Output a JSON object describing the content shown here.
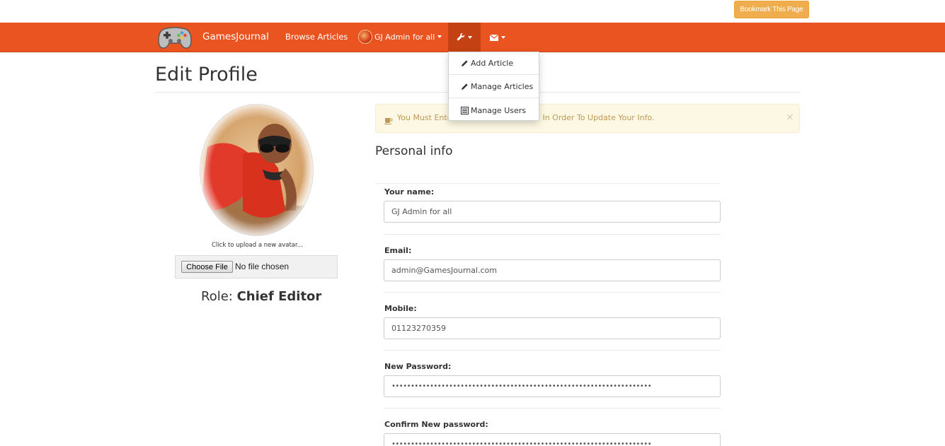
{
  "topbar": {
    "bookmark_label": "Bookmark This Page"
  },
  "navbar": {
    "brand": "GamesJournal",
    "browse_label": "Browse Articles",
    "user_label": "GJ Admin for all",
    "tools_icon": "wrench-icon",
    "mail_icon": "envelope-icon",
    "accent_color": "#e95420",
    "active_color": "#c34113"
  },
  "tools_menu": {
    "items": [
      {
        "label": "Add Article",
        "icon": "pencil-icon"
      },
      {
        "label": "Manage Articles",
        "icon": "pencil-icon"
      },
      {
        "label": "Manage Users",
        "icon": "list-icon"
      }
    ]
  },
  "page": {
    "title": "Edit Profile"
  },
  "profile": {
    "avatar_caption": "Click to upload a new avatar...",
    "choose_file_label": "Choose File",
    "no_file_label": "No file chosen",
    "role_prefix": "Role:",
    "role_value": "Chief Editor"
  },
  "alert": {
    "icon": "coffee-icon",
    "text_start": "You Must Ente",
    "text_end": "In Order To Update Your Info.",
    "close": "×"
  },
  "form": {
    "section_title": "Personal info",
    "fields": [
      {
        "label": "Your name:",
        "value": "GJ Admin for all"
      },
      {
        "label": "Email:",
        "value": "admin@GamesJournal.com"
      },
      {
        "label": "Mobile:",
        "value": "01123270359"
      },
      {
        "label": "New Password:",
        "value": "••••••••••••••••••••••••••••••••••••••••••••••••••••••••••••••••••••"
      },
      {
        "label": "Confirm New password:",
        "value": "••••••••••••••••••••••••••••••••••••••••••••••••••••••••••••••••••••"
      }
    ]
  }
}
